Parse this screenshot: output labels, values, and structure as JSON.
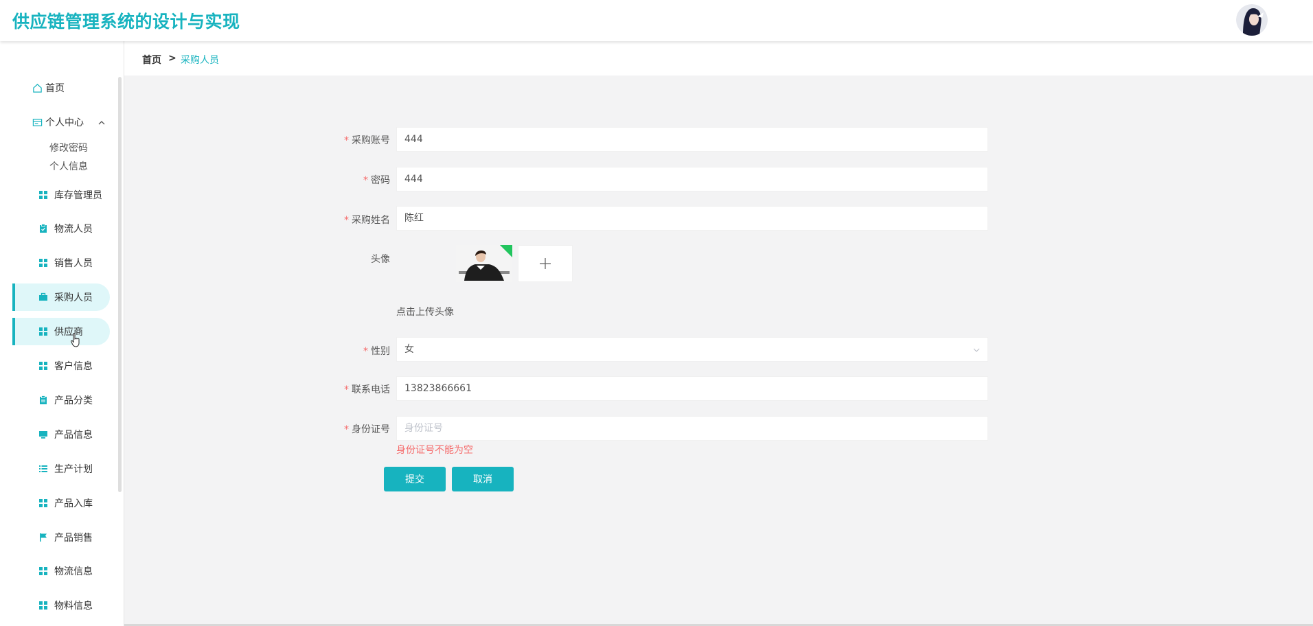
{
  "app": {
    "title": "供应链管理系统的设计与实现"
  },
  "sidebar": {
    "home": "首页",
    "personal": "个人中心",
    "personal_sub": [
      "修改密码",
      "个人信息"
    ],
    "items": [
      {
        "label": "库存管理员",
        "icon": "grid-icon"
      },
      {
        "label": "物流人员",
        "icon": "clipboard-icon"
      },
      {
        "label": "销售人员",
        "icon": "grid-icon"
      },
      {
        "label": "采购人员",
        "icon": "briefcase-icon"
      },
      {
        "label": "供应商",
        "icon": "grid-icon"
      },
      {
        "label": "客户信息",
        "icon": "grid-icon"
      },
      {
        "label": "产品分类",
        "icon": "clipboard-icon"
      },
      {
        "label": "产品信息",
        "icon": "monitor-icon"
      },
      {
        "label": "生产计划",
        "icon": "list-icon"
      },
      {
        "label": "产品入库",
        "icon": "grid-icon"
      },
      {
        "label": "产品销售",
        "icon": "flag-icon"
      },
      {
        "label": "物流信息",
        "icon": "grid-icon"
      },
      {
        "label": "物料信息",
        "icon": "grid-icon"
      }
    ]
  },
  "breadcrumb": {
    "home": "首页",
    "separator": ">",
    "current": "采购人员"
  },
  "form": {
    "account": {
      "label": "采购账号",
      "value": "444"
    },
    "password": {
      "label": "密码",
      "value": "444"
    },
    "name": {
      "label": "采购姓名",
      "value": "陈红"
    },
    "avatar": {
      "label": "头像",
      "hint": "点击上传头像"
    },
    "gender": {
      "label": "性别",
      "value": "女"
    },
    "phone": {
      "label": "联系电话",
      "value": "13823866661"
    },
    "idcard": {
      "label": "身份证号",
      "placeholder": "身份证号",
      "error": "身份证号不能为空"
    },
    "required_mark": "*",
    "submit": "提交",
    "cancel": "取消"
  },
  "colors": {
    "accent": "#17b3bf",
    "error": "#f56c6c",
    "active_bg": "#dff7f9"
  }
}
